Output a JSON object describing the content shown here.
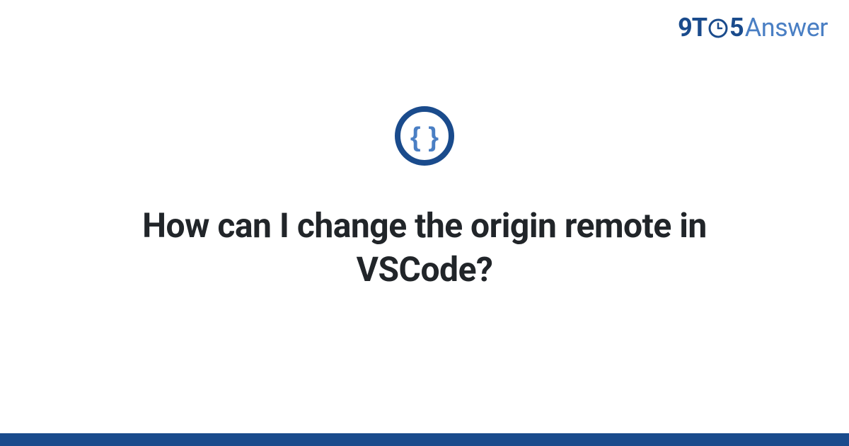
{
  "brand": {
    "part1": "9T",
    "part2": "5",
    "part3": "Answer"
  },
  "question": {
    "title": "How can I change the origin remote in VSCode?"
  },
  "colors": {
    "primary_dark": "#1a4b8c",
    "primary_light": "#4a7fc4",
    "text": "#212529",
    "background": "#ffffff"
  }
}
